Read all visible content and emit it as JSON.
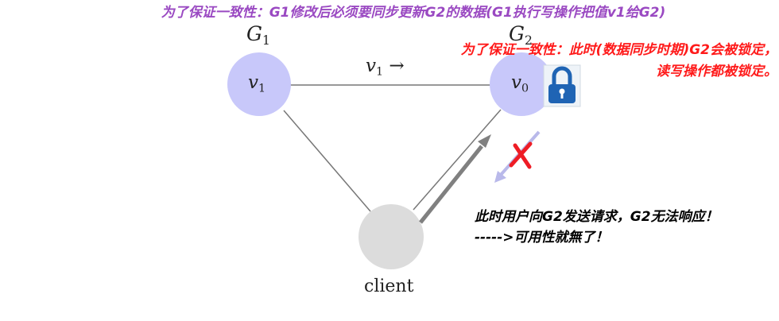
{
  "banner": "为了保证一致性：G1修改后必须要同步更新G2的数据(G1执行写操作把值v1给G2)",
  "g1": {
    "title_base": "G",
    "title_sub": "1",
    "value_base": "v",
    "value_sub": "1"
  },
  "g2": {
    "title_base": "G",
    "title_sub": "2",
    "value_base": "v",
    "value_sub": "0"
  },
  "edge": {
    "label_base": "v",
    "label_sub": "1",
    "arrow": "→"
  },
  "client": {
    "label": "client"
  },
  "lock_note": {
    "line1": "为了保证一致性：此时(数据同步时期)G2会被锁定，",
    "line2": "读写操作都被锁定。"
  },
  "request_note": {
    "line1": "此时用户向G2发送请求，G2无法响应！",
    "line2": "----->可用性就無了！"
  },
  "icons": {
    "lock": "padlock-icon",
    "blocked": "x-mark-icon"
  },
  "colors": {
    "node_fill": "#c8c8fa",
    "client_fill": "#dcdcdc",
    "banner": "#9a49c2",
    "warning": "#ff1a1a",
    "request_arrow": "#808080",
    "response_arrow": "#b9b9ea",
    "lock_blue": "#1f64b4"
  }
}
